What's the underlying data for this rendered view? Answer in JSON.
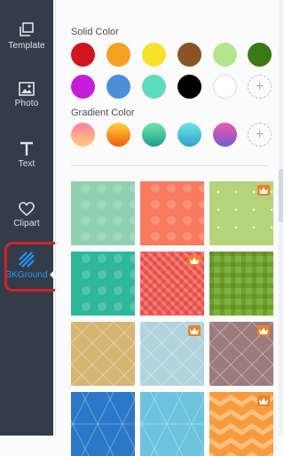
{
  "sidebar": {
    "items": [
      {
        "label": "Template",
        "icon": "template-icon"
      },
      {
        "label": "Photo",
        "icon": "photo-icon"
      },
      {
        "label": "Text",
        "icon": "text-icon"
      },
      {
        "label": "Clipart",
        "icon": "clipart-heart-icon"
      },
      {
        "label": "BKGround",
        "icon": "background-icon",
        "active": true
      }
    ],
    "accent": "#1e9bff",
    "highlight_outline_color": "#d6202a"
  },
  "panel": {
    "solid_title": "Solid Color",
    "solid_colors": [
      "#d2141e",
      "#f5a021",
      "#f7e12a",
      "#8b5424",
      "#b4e58e",
      "#3a7a16",
      "#c41ed9",
      "#4b8fdb",
      "#5ddcbd",
      "#000000",
      "#ffffff"
    ],
    "gradient_title": "Gradient Color",
    "gradients": [
      [
        "#ff7fa0",
        "#ffcd7a"
      ],
      [
        "#ffd23a",
        "#f25a12"
      ],
      [
        "#6de8a7",
        "#1f9c8e"
      ],
      [
        "#6ce8e6",
        "#2fa1c9"
      ],
      [
        "#ec5aa6",
        "#7a58d9"
      ]
    ],
    "add_symbol": "+",
    "patterns": [
      {
        "name": "mint-dots",
        "bg": "#8fd0b1",
        "premium": false
      },
      {
        "name": "coral-dots",
        "bg": "#fb7a5e",
        "premium": false
      },
      {
        "name": "lime-stars",
        "bg": "#b5d47a",
        "premium": true
      },
      {
        "name": "teal-dots",
        "bg": "#2fb79b",
        "premium": false
      },
      {
        "name": "red-weave",
        "bg": "#f25a54",
        "premium": true
      },
      {
        "name": "green-plaid",
        "bg": "#7fb23a",
        "premium": false
      },
      {
        "name": "tan-diamonds",
        "bg": "#d6b471",
        "premium": false
      },
      {
        "name": "lightblue-diamonds",
        "bg": "#b1d3dd",
        "premium": true
      },
      {
        "name": "mauve-diamonds",
        "bg": "#9b7b7b",
        "premium": true
      },
      {
        "name": "blue-triangles",
        "bg": "#2a78c7",
        "premium": false
      },
      {
        "name": "sky-triangles",
        "bg": "#6bc3e0",
        "premium": false
      },
      {
        "name": "orange-zigzag",
        "bg": "#f79a3a",
        "premium": true
      }
    ]
  }
}
